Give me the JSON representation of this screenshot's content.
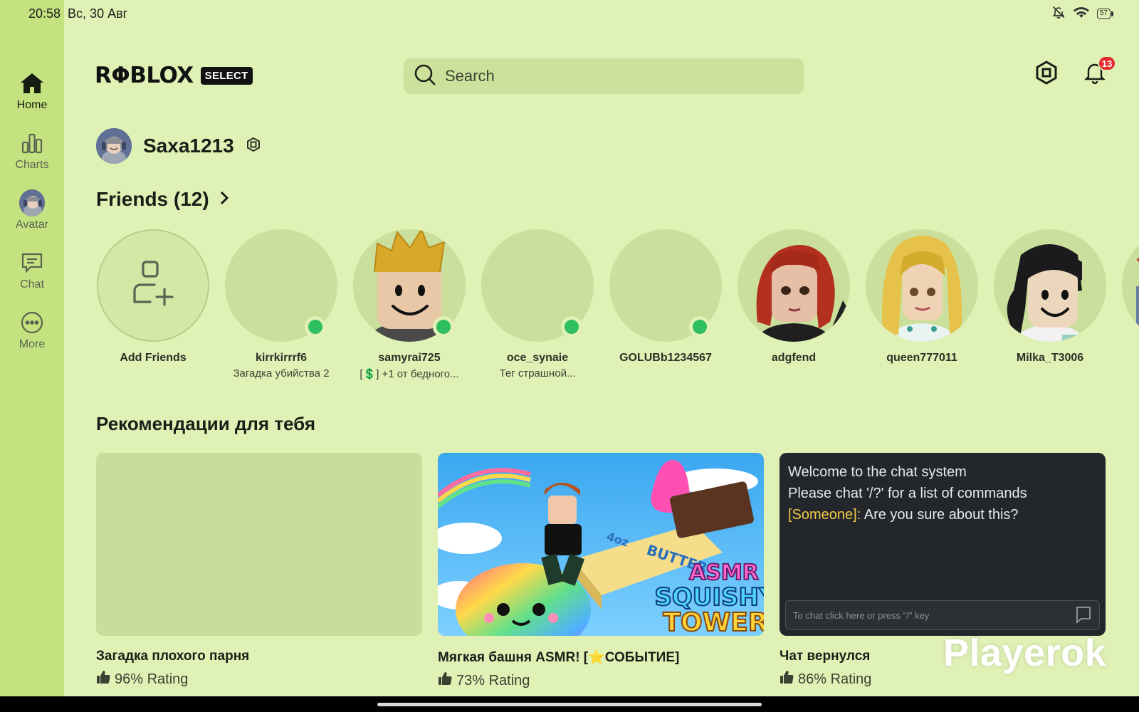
{
  "status_bar": {
    "time": "20:58",
    "date": "Вс, 30 Авг",
    "battery": "57"
  },
  "nav": {
    "items": [
      {
        "id": "home",
        "label": "Home",
        "icon": "home-icon",
        "active": true
      },
      {
        "id": "charts",
        "label": "Charts",
        "icon": "charts-icon",
        "active": false
      },
      {
        "id": "avatar",
        "label": "Avatar",
        "icon": "avatar-icon",
        "active": false
      },
      {
        "id": "chat",
        "label": "Chat",
        "icon": "chat-icon",
        "active": false
      },
      {
        "id": "more",
        "label": "More",
        "icon": "more-icon",
        "active": false
      }
    ]
  },
  "header": {
    "logo": "RΦBLOX",
    "logo_badge": "SELECT",
    "search_placeholder": "Search",
    "notification_count": "13"
  },
  "profile": {
    "username": "Saxa1213"
  },
  "friends": {
    "title": "Friends (12)",
    "add_label": "Add Friends",
    "list": [
      {
        "name": "kirrkirrrf6",
        "status": "Загадка убийства 2",
        "online": true,
        "avatar": "blank"
      },
      {
        "name": "samyrai725",
        "status": "[💲] +1 от бедного...",
        "online": true,
        "avatar": "blond-boy"
      },
      {
        "name": "oce_synaie",
        "status": "Тег страшной...",
        "online": true,
        "avatar": "blank"
      },
      {
        "name": "GOLUBb1234567",
        "status": "",
        "online": true,
        "avatar": "blank"
      },
      {
        "name": "adgfend",
        "status": "",
        "online": false,
        "avatar": "redhead"
      },
      {
        "name": "queen777011",
        "status": "",
        "online": false,
        "avatar": "blonde-girl"
      },
      {
        "name": "Milka_T3006",
        "status": "",
        "online": false,
        "avatar": "dark-hair"
      }
    ]
  },
  "recommendations": {
    "title": "Рекомендации для тебя",
    "items": [
      {
        "title": "Загадка плохого парня",
        "rating": "96% Rating",
        "thumb": "blank"
      },
      {
        "title": "Мягкая башня ASMR! [⭐СОБЫТИЕ]",
        "rating": "73% Rating",
        "thumb": "asmr",
        "art": {
          "box": "4oz",
          "butter": "BUTTER",
          "line1": "ASMR",
          "line2": "SQUISHY",
          "line3": "TOWER"
        }
      },
      {
        "title": "Чат вернулся",
        "rating": "86% Rating",
        "thumb": "chat",
        "chat": {
          "line1": "Welcome to the chat system",
          "line2": "Please chat '/?' for a list of commands",
          "speaker": "[Someone]:",
          "message": " Are you sure about this?",
          "input_placeholder": "To chat click here or press \"/\" key"
        }
      }
    ]
  },
  "watermark": "Playerok",
  "colors": {
    "background": "#e0f1b6",
    "sidebar": "#c4e380",
    "online": "#2fbf60",
    "badge": "#e32b2b"
  }
}
